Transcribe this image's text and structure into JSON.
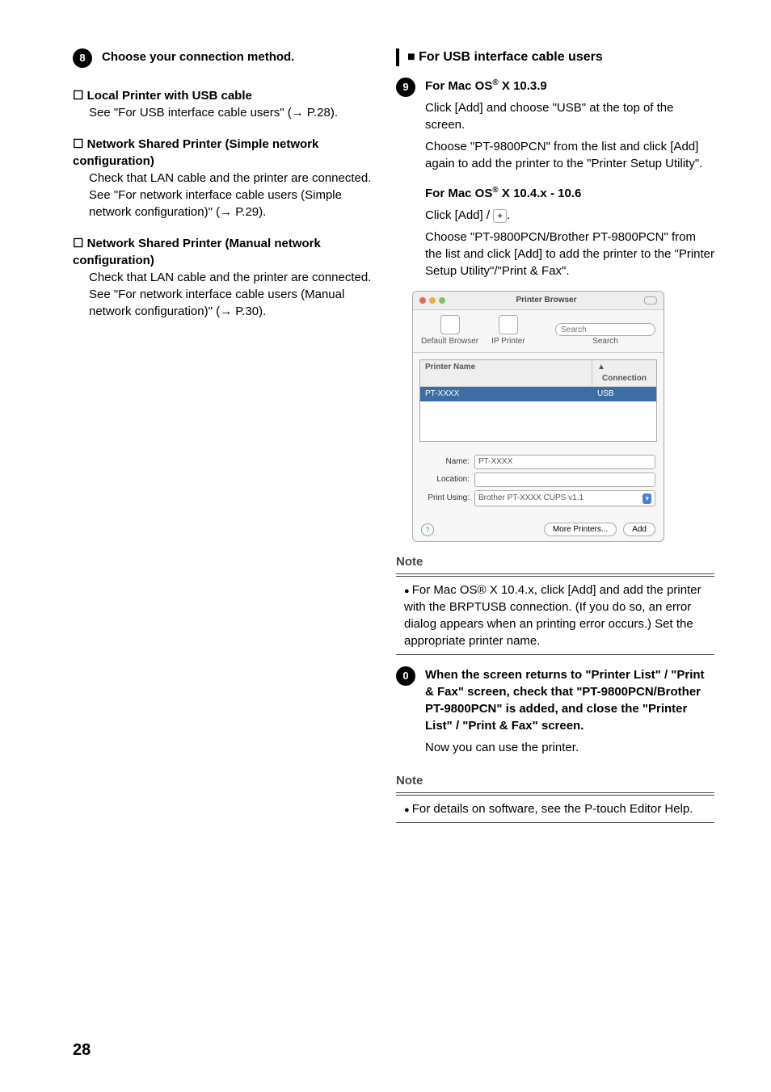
{
  "left": {
    "step8": {
      "num": "8",
      "title": "Choose your connection method.",
      "opt1": {
        "title": "Local Printer with USB cable",
        "body": "See \"For USB interface cable users\" (→ P.28)."
      },
      "opt2": {
        "title": "Network Shared Printer (Simple network configuration)",
        "body1": "Check that LAN cable and the printer are connected.",
        "body2": "See \"For network interface cable users (Simple network configuration)\" (→ P.29)."
      },
      "opt3": {
        "title": "Network Shared Printer (Manual network configuration)",
        "body1": "Check that LAN cable and the printer are connected.",
        "body2": "See \"For network interface cable users (Manual network configuration)\" (→ P.30)."
      }
    }
  },
  "right": {
    "section_title": "For USB interface cable users",
    "step9": {
      "num": "9",
      "h1_a": "For Mac OS",
      "h1_sup": "®",
      "h1_b": " X 10.3.9",
      "p1": "Click [Add] and choose \"USB\" at the top of the screen.",
      "p2": "Choose \"PT-9800PCN\" from the list and click [Add] again to add the printer to the \"Printer Setup Utility\".",
      "h2_a": "For Mac OS",
      "h2_sup": "®",
      "h2_b": " X 10.4.x - 10.6",
      "p3a": "Click [Add] / ",
      "p3b": ".",
      "p4": "Choose \"PT-9800PCN/Brother PT-9800PCN\" from the list and click [Add] to add the printer to the \"Printer Setup Utility\"/\"Print & Fax\"."
    },
    "shot": {
      "title": "Printer Browser",
      "tool1": "Default Browser",
      "tool2": "IP Printer",
      "search_label": "Search",
      "col1": "Printer Name",
      "col2": "Connection",
      "row1_name": "PT-XXXX",
      "row1_conn": "USB",
      "name_label": "Name:",
      "name_value": "PT-XXXX",
      "loc_label": "Location:",
      "loc_value": "",
      "print_label": "Print Using:",
      "print_value": "Brother PT-XXXX  CUPS v1.1",
      "btn_more": "More Printers...",
      "btn_add": "Add"
    },
    "note1": {
      "title": "Note",
      "body": "For Mac OS® X 10.4.x, click [Add] and add the printer with the BRPTUSB connection. (If you do so, an error dialog appears when an printing error occurs.) Set the appropriate printer name."
    },
    "step10": {
      "num": "0",
      "head": "When the screen returns to \"Printer List\" / \"Print & Fax\" screen, check that \"PT-9800PCN/Brother PT-9800PCN\" is added, and close the \"Printer List\" / \"Print & Fax\" screen.",
      "body": "Now you can use the printer."
    },
    "note2": {
      "title": "Note",
      "body": "For details on software, see the P-touch Editor Help."
    }
  },
  "page_number": "28"
}
